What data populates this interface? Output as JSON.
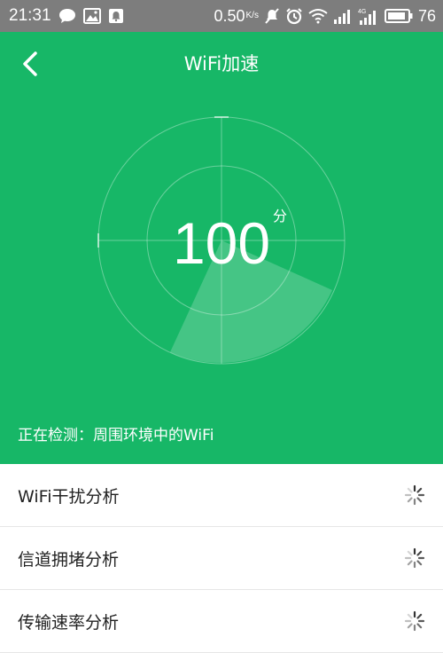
{
  "status_bar": {
    "time": "21:31",
    "left_icons": [
      "chat-bubble-icon",
      "image-icon",
      "notification-icon"
    ],
    "net_speed": "0.50",
    "net_speed_unit": "K/s",
    "battery": "76",
    "network_label": "4G"
  },
  "header": {
    "title": "WiFi加速"
  },
  "radar": {
    "score": "100",
    "score_unit": "分",
    "detect_text": "正在检测：周围环境中的WiFi"
  },
  "colors": {
    "primary_green": "#17b767",
    "status_bar_gray": "#7d7d7d",
    "text_dark": "#222222"
  },
  "list": {
    "items": [
      {
        "label": "WiFi干扰分析",
        "icon": "loading-spinner-icon"
      },
      {
        "label": "信道拥堵分析",
        "icon": "loading-spinner-icon"
      },
      {
        "label": "传输速率分析",
        "icon": "loading-spinner-icon"
      }
    ]
  }
}
